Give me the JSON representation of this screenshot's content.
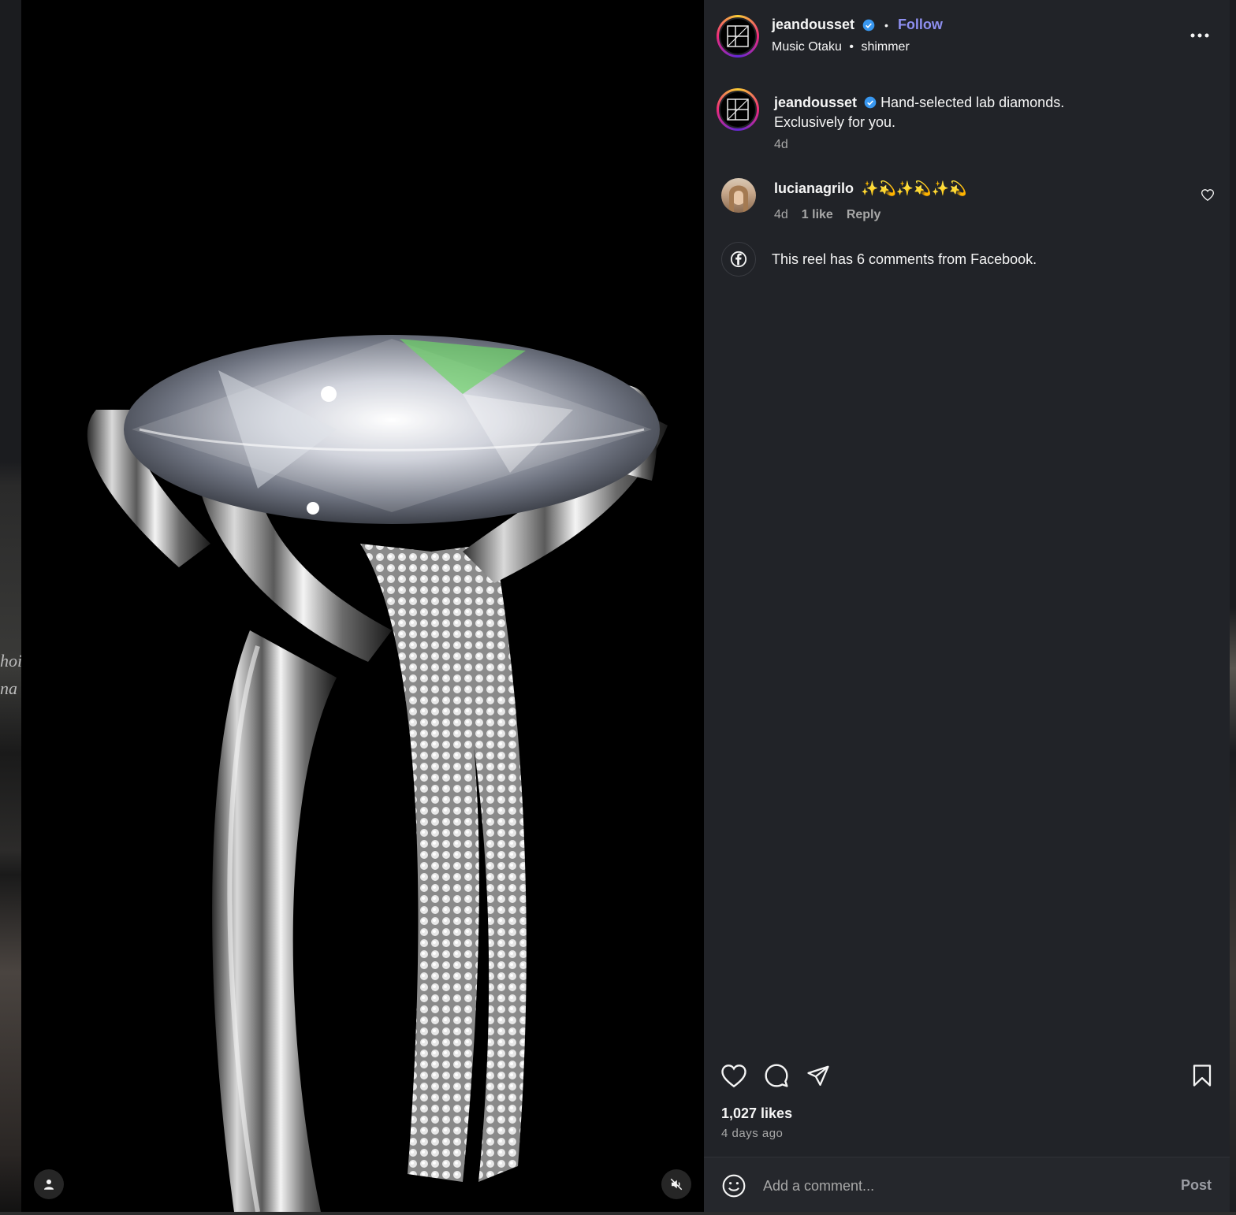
{
  "post": {
    "username": "jeandousset",
    "follow_label": "Follow",
    "separator": "•",
    "audio_artist": "Music Otaku",
    "audio_track": "shimmer",
    "more_label": "...",
    "caption_text": "Hand-selected lab diamonds.",
    "caption_line2": "Exclusively for you.",
    "caption_time": "4d"
  },
  "comments": [
    {
      "username": "lucianagrilo",
      "text": "✨💫✨💫✨💫",
      "time": "4d",
      "likes": "1 like",
      "reply_label": "Reply"
    }
  ],
  "facebook_note": "This reel has 6 comments from Facebook.",
  "stats": {
    "likes": "1,027 likes",
    "posted": "4 days ago"
  },
  "comment_box": {
    "placeholder": "Add a comment...",
    "post_label": "Post"
  },
  "background": {
    "ghost_text_1": "hoi",
    "ghost_text_2": "na"
  },
  "colors": {
    "panel_bg": "#212328",
    "accent_blue": "#8e8ff0",
    "verified_blue": "#3897f0"
  }
}
